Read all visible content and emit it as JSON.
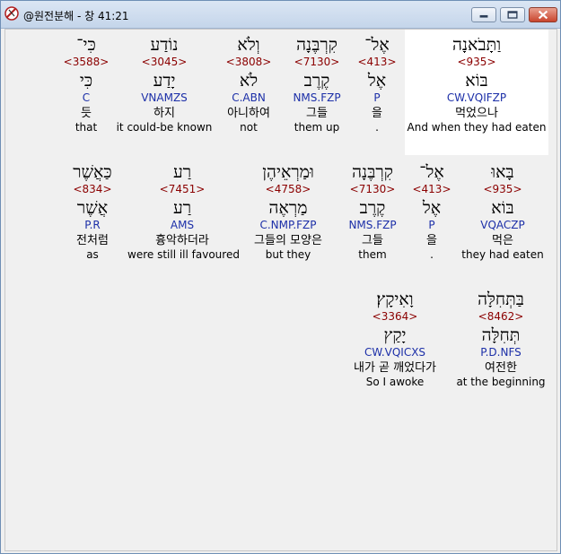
{
  "window": {
    "title": "@원전분해 - 창 41:21"
  },
  "rows": [
    {
      "words": [
        {
          "heb": "כִּי־",
          "num": "<3588>",
          "root": "כִּי",
          "parse": "C",
          "kor": "듯",
          "eng": "that"
        },
        {
          "heb": "נוֹדַע",
          "num": "<3045>",
          "root": "יָדַע",
          "parse": "VNAMZS",
          "kor": "하지",
          "eng": "it could-be known"
        },
        {
          "heb": "וְלֹא",
          "num": "<3808>",
          "root": "לֹא",
          "parse": "C.ABN",
          "kor": "아니하여",
          "eng": "not"
        },
        {
          "heb": "קִרְבֶּנָה",
          "num": "<7130>",
          "root": "קֶרֶב",
          "parse": "NMS.FZP",
          "kor": "그들",
          "eng": "them up"
        },
        {
          "heb": "אֶל־",
          "num": "<413>",
          "root": "אֶל",
          "parse": "P",
          "kor": "을",
          "eng": "."
        },
        {
          "heb": "וַתָּבֹאנָה",
          "num": "<935>",
          "root": "בּוֹא",
          "parse": "CW.VQIFZP",
          "kor": "먹었으나",
          "eng": "And when they had eaten"
        }
      ]
    },
    {
      "words": [
        {
          "heb": "כַּאֲשֶׁר",
          "num": "<834>",
          "root": "אֲשֶׁר",
          "parse": "P.R",
          "kor": "전처럼",
          "eng": "as"
        },
        {
          "heb": "רַע",
          "num": "<7451>",
          "root": "רַע",
          "parse": "AMS",
          "kor": "흉악하더라",
          "eng": "were still ill favoured"
        },
        {
          "heb": "וּמַרְאֵיהֶן",
          "num": "<4758>",
          "root": "מַרְאֶה",
          "parse": "C.NMP.FZP",
          "kor": "그들의 모양은",
          "eng": "but they"
        },
        {
          "heb": "קִרְבֶּנָה",
          "num": "<7130>",
          "root": "קֶרֶב",
          "parse": "NMS.FZP",
          "kor": "그들",
          "eng": "them"
        },
        {
          "heb": "אֶל־",
          "num": "<413>",
          "root": "אֶל",
          "parse": "P",
          "kor": "을",
          "eng": "."
        },
        {
          "heb": "בָּאוּ",
          "num": "<935>",
          "root": "בּוֹא",
          "parse": "VQACZP",
          "kor": "먹은",
          "eng": "they had eaten"
        }
      ]
    },
    {
      "words": [
        {
          "heb": "וָאִיקָץ׃",
          "num": "<3364>",
          "root": "יָקַץ",
          "parse": "CW.VQICXS",
          "kor": "내가 곧 깨었다가",
          "eng": "So I awoke"
        },
        {
          "heb": "בַּתְּחִלָּה",
          "num": "<8462>",
          "root": "תְּחִלָּה",
          "parse": "P.D.NFS",
          "kor": "여전한",
          "eng": "at the beginning"
        }
      ]
    }
  ]
}
